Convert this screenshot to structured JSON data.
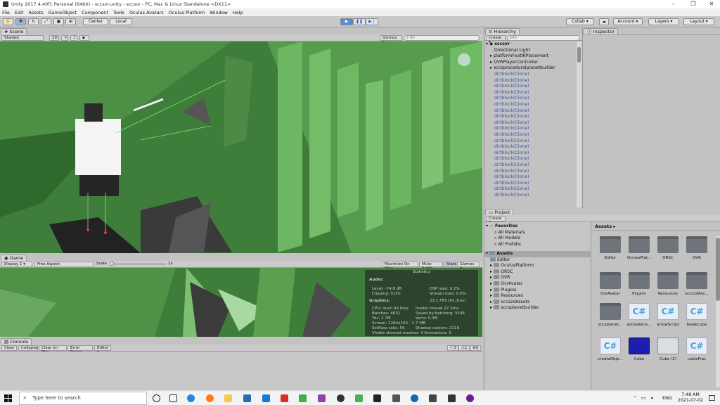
{
  "window": {
    "title": "Unity 2017.4.40f1 Personal (64bit) - sccsvr.unity - sccsvr - PC, Mac & Linux Standalone <DX11>",
    "minimize": "–",
    "restore": "❐",
    "close": "✕"
  },
  "menu": [
    "File",
    "Edit",
    "Assets",
    "GameObject",
    "Component",
    "Tools",
    "Oculus Avatars",
    "Oculus Platform",
    "Window",
    "Help"
  ],
  "toolbar": {
    "center": "Center",
    "local": "Local",
    "collab": "Collab ▾",
    "account": "Account ▾",
    "layers": "Layers ▾",
    "layout": "Layout ▾",
    "play_state": "playing"
  },
  "scene": {
    "tab": "Scene",
    "shading": "Shaded",
    "mode2d": "2D",
    "gizmos": "Gizmos ▾",
    "search": "All"
  },
  "game": {
    "tab": "Game",
    "display": "Display 1",
    "aspect": "Free Aspect",
    "scale_label": "Scale",
    "scale_value": "1x",
    "maximize": "Maximize On Play",
    "mute": "Mute Audio",
    "stats": "Stats",
    "gizmos": "Gizmos ▾"
  },
  "stats": {
    "title": "Statistics",
    "audio_head": "Audio:",
    "level": "Level: -74.8 dB",
    "clipping": "Clipping: 0.0%",
    "dsp": "DSP load: 0.2%",
    "stream": "Stream load: 0.0%",
    "graphics_head": "Graphics:",
    "fps": "23.1 FPS (43.3ms)",
    "cpu": "CPU: main 43.0ms",
    "render": "render thread 27.3ms",
    "batches": "Batches: 4631",
    "saved": "Saved by batching: 3546",
    "tris": "Tris: 2.7M",
    "verts": "Verts: 5.3M",
    "screen": "Screen: 1284x163 - 2.7 MB",
    "setpass": "SetPass calls: 56",
    "shadows": "Shadow casters: 2118",
    "skinned": "Visible skinned meshes: 4  Animations: 0"
  },
  "console": {
    "tab": "Console",
    "clear": "Clear",
    "collapse": "Collapse",
    "clear_on_play": "Clear on Play",
    "error_pause": "Error Pause",
    "editor": "Editor ▾",
    "count_log": "3",
    "count_warn": "1",
    "count_err": "0"
  },
  "hierarchy": {
    "tab": "Hierarchy",
    "create": "Create ▾",
    "search": "All",
    "scene": "sccsvr",
    "items": [
      "Directional Light",
      "platformFootIKPlacement",
      "OVRPlayerController",
      "sccsproceduralplanetbuilder",
      "dirtblock(Clone)",
      "dirtblock(Clone)",
      "dirtblock(Clone)",
      "dirtblock(Clone)",
      "dirtblock(Clone)",
      "dirtblock(Clone)",
      "dirtblock(Clone)",
      "dirtblock(Clone)",
      "dirtblock(Clone)",
      "dirtblock(Clone)",
      "dirtblock(Clone)",
      "dirtblock(Clone)",
      "dirtblock(Clone)",
      "dirtblock(Clone)",
      "dirtblock(Clone)",
      "dirtblock(Clone)",
      "dirtblock(Clone)",
      "dirtblock(Clone)",
      "dirtblock(Clone)",
      "dirtblock(Clone)",
      "dirtblock(Clone)"
    ]
  },
  "inspector": {
    "tab": "Inspector"
  },
  "project": {
    "tab": "Project",
    "create": "Create ▾",
    "favorites": "Favorites",
    "fav_items": [
      "All Materials",
      "All Models",
      "All Prefabs"
    ],
    "assets": "Assets",
    "tree": [
      "Editor",
      "OculusPlatform",
      "ORSC",
      "OVR",
      "OvrAvatar",
      "Plugins",
      "Resources",
      "sccs2dAssets",
      "sccsplanetbuilder"
    ],
    "breadcrumb": "Assets ▸",
    "grid": [
      {
        "label": "Editor",
        "kind": "folder"
      },
      {
        "label": "OculusPlat...",
        "kind": "folder"
      },
      {
        "label": "ORSC",
        "kind": "folder"
      },
      {
        "label": "OVR",
        "kind": "folder"
      },
      {
        "label": "OvrAvatar",
        "kind": "folder"
      },
      {
        "label": "Plugins",
        "kind": "folder"
      },
      {
        "label": "Resources",
        "kind": "folder"
      },
      {
        "label": "sccs2dAss...",
        "kind": "folder"
      },
      {
        "label": "sccsplanet...",
        "kind": "folder"
      },
      {
        "label": "activateCe...",
        "kind": "script"
      },
      {
        "label": "arrowScript",
        "kind": "script"
      },
      {
        "label": "breakcube",
        "kind": "script"
      },
      {
        "label": "createObje...",
        "kind": "script"
      },
      {
        "label": "Cube",
        "kind": "cube-blue"
      },
      {
        "label": "Cube (2)",
        "kind": "cube-grey"
      },
      {
        "label": "cubicFrac",
        "kind": "script"
      }
    ]
  },
  "taskbar": {
    "search": "Type here to search",
    "lang": "ENG",
    "time": "7:48 AM",
    "date": "2021-07-02"
  }
}
